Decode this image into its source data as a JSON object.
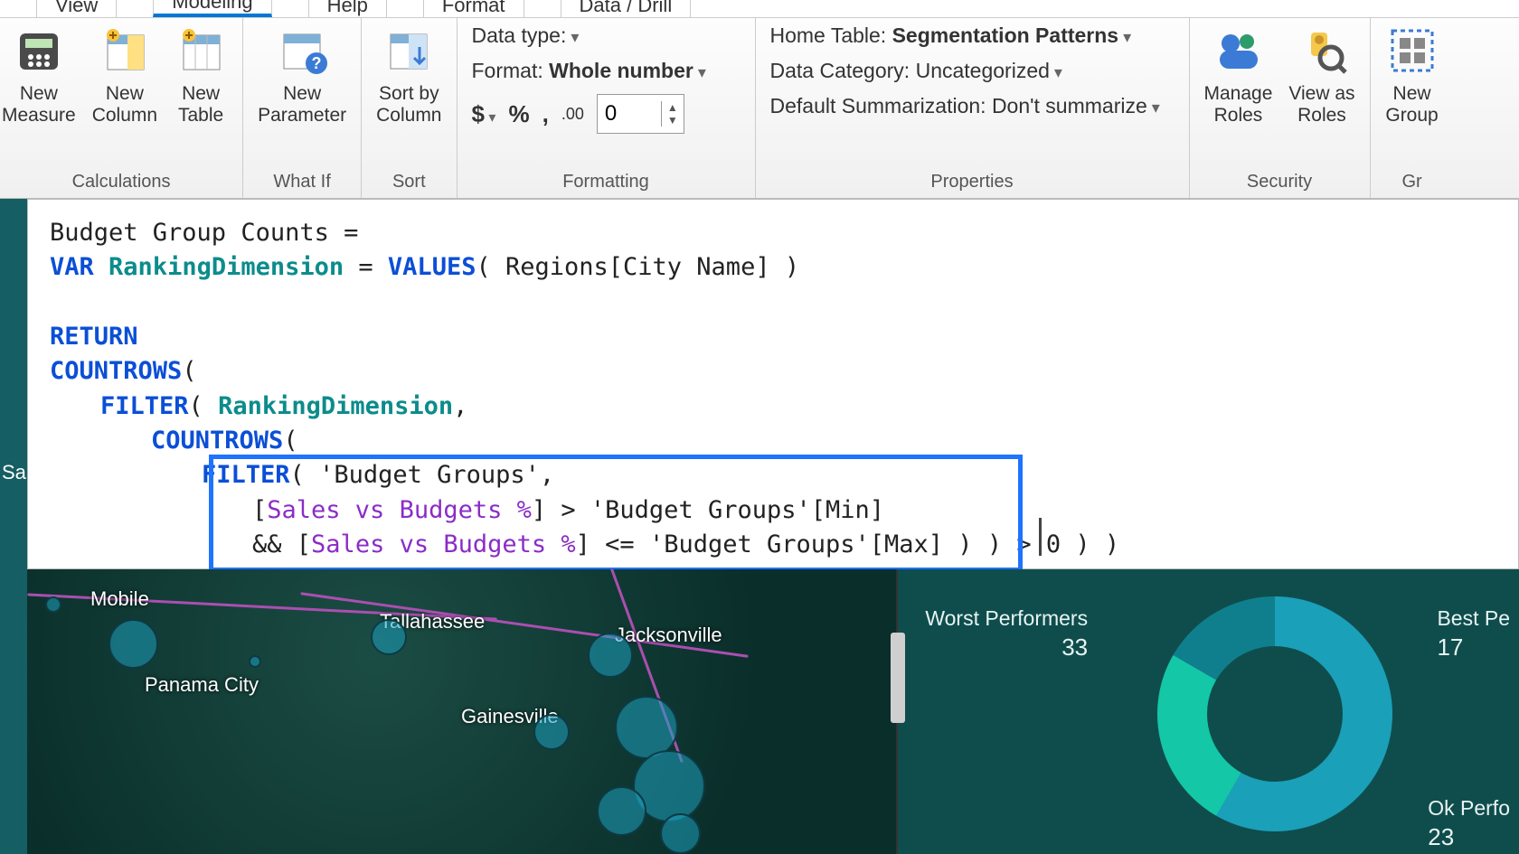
{
  "tabs": {
    "view": "View",
    "modeling": "Modeling",
    "help": "Help",
    "format": "Format",
    "datadrill": "Data / Drill"
  },
  "ribbon": {
    "calculations": {
      "label": "Calculations",
      "new_measure_l1": "New",
      "new_measure_l2": "Measure",
      "new_column_l1": "New",
      "new_column_l2": "Column",
      "new_table_l1": "New",
      "new_table_l2": "Table"
    },
    "whatif": {
      "label": "What If",
      "new_param_l1": "New",
      "new_param_l2": "Parameter"
    },
    "sort": {
      "label": "Sort",
      "sortby_l1": "Sort by",
      "sortby_l2": "Column"
    },
    "formatting": {
      "label": "Formatting",
      "datatype": "Data type:",
      "format_label": "Format:",
      "format_value": "Whole number",
      "currency": "$",
      "percent": "%",
      "thousands": ",",
      "decimal_icon": ".00",
      "decimals_value": "0"
    },
    "properties": {
      "label": "Properties",
      "hometable_label": "Home Table:",
      "hometable_value": "Segmentation Patterns",
      "datacat_label": "Data Category:",
      "datacat_value": "Uncategorized",
      "summ_label": "Default Summarization:",
      "summ_value": "Don't summarize"
    },
    "security": {
      "label": "Security",
      "manage_l1": "Manage",
      "manage_l2": "Roles",
      "viewas_l1": "View as",
      "viewas_l2": "Roles"
    },
    "groups": {
      "label": "Gr",
      "new_group_l1": "New",
      "new_group_l2": "Group"
    }
  },
  "formula": {
    "line1": "Budget Group Counts =",
    "var_kw": "VAR",
    "var_name": "RankingDimension",
    "eq": " = ",
    "values_fn": "VALUES",
    "values_arg": "( Regions[City Name] )",
    "return_kw": "RETURN",
    "countrows1": "COUNTROWS",
    "open1": "(",
    "filter1": "FILTER",
    "filter1_args_a": "( ",
    "rankdim": "RankingDimension",
    "filter1_args_b": ",",
    "countrows2": "COUNTROWS",
    "open2": "(",
    "filter2": "FILTER",
    "filter2_arg_table": "( 'Budget Groups',",
    "meas1_open": "[",
    "meas1": "Sales vs Budgets %",
    "meas1_close": "]",
    "gt_min": " > 'Budget Groups'[Min]",
    "and": "&& ",
    "meas2_open": "[",
    "meas2": "Sales vs Budgets %",
    "meas2_close": "]",
    "le_max": " <= 'Budget Groups'[Max] ) ) > 0 ) )"
  },
  "map": {
    "mobile": "Mobile",
    "tallahassee": "Tallahassee",
    "jacksonville": "Jacksonville",
    "panama": "Panama City",
    "gainesville": "Gainesville"
  },
  "donut": {
    "worst_label": "Worst Performers",
    "worst_val": "33",
    "best_label": "Best Pe",
    "best_val": "17",
    "ok_label": "Ok Perfo",
    "ok_val": "23"
  },
  "chart_data": {
    "type": "pie",
    "title": "",
    "series": [
      {
        "name": "Worst Performers",
        "value": 33
      },
      {
        "name": "Ok Performers",
        "value": 23
      },
      {
        "name": "Best Performers",
        "value": 17
      }
    ]
  },
  "side_label": "Sa"
}
